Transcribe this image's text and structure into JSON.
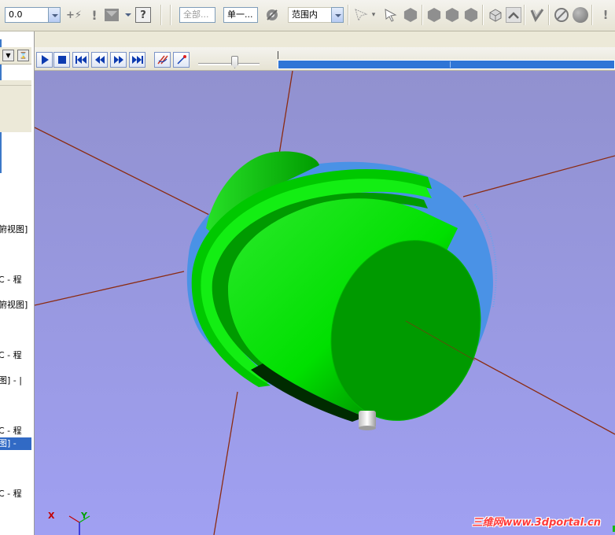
{
  "toolbar": {
    "value_field": "0.0",
    "filter_all": "全部...",
    "select_single": "单一...",
    "scope": "范围内"
  },
  "tree": {
    "items": [
      "俯视图]",
      "C - 程",
      "俯视图]",
      "C - 程",
      "图] - |",
      "C - 程",
      "图] -",
      "C - 程"
    ],
    "selected_index": 6
  },
  "axes": {
    "x_label": "X",
    "y_label": "Y"
  },
  "watermark": "三维网www.3dportal.cn",
  "colors": {
    "background_top": "#9191cf",
    "background_bottom": "#a0a0f2",
    "part_green": "#00e400",
    "stock_blue": "#4a92e6",
    "axis_line": "#8b2b12",
    "watermark": "#ff3a3a"
  },
  "icons": {
    "play": "play-icon",
    "stop": "stop-icon",
    "to_start": "skip-start-icon",
    "step_back": "step-back-icon",
    "step_forward": "step-forward-icon",
    "to_end": "skip-end-icon"
  }
}
